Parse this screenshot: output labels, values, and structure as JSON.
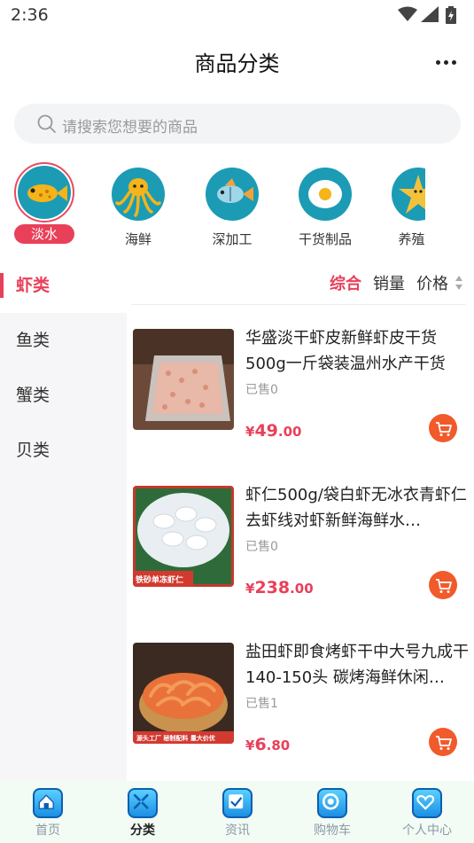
{
  "status_bar": {
    "time": "2:36"
  },
  "header": {
    "title": "商品分类"
  },
  "search": {
    "placeholder": "请搜索您想要的商品"
  },
  "categories": [
    {
      "label": "淡水",
      "icon": "fish-icon",
      "active": true
    },
    {
      "label": "海鲜",
      "icon": "octopus-icon",
      "active": false
    },
    {
      "label": "深加工",
      "icon": "tropical-fish-icon",
      "active": false
    },
    {
      "label": "干货制品",
      "icon": "egg-icon",
      "active": false
    },
    {
      "label": "养殖原",
      "icon": "starfish-icon",
      "active": false
    }
  ],
  "side_nav": [
    {
      "label": "虾类",
      "active": true
    },
    {
      "label": "鱼类",
      "active": false
    },
    {
      "label": "蟹类",
      "active": false
    },
    {
      "label": "贝类",
      "active": false
    }
  ],
  "sort": {
    "comprehensive": "综合",
    "sales": "销量",
    "price": "价格"
  },
  "products": [
    {
      "title": "华盛淡干虾皮新鲜虾皮干货500g一斤袋装温州水产干货",
      "sold": "已售0",
      "price_currency": "¥",
      "price_int": "49",
      "price_dec": ".00"
    },
    {
      "title": "虾仁500g/袋白虾无冰衣青虾仁去虾线对虾新鲜海鲜水…",
      "sold": "已售0",
      "price_currency": "¥",
      "price_int": "238",
      "price_dec": ".00",
      "image_text": "铁砂单冻虾仁"
    },
    {
      "title": "盐田虾即食烤虾干中大号九成干140-150头 碳烤海鲜休闲…",
      "sold": "已售1",
      "price_currency": "¥",
      "price_int": "6",
      "price_dec": ".80",
      "image_text": "源头工厂 秘制配料 量大价优"
    }
  ],
  "tab_bar": [
    {
      "label": "首页",
      "icon": "home-icon",
      "active": false
    },
    {
      "label": "分类",
      "icon": "category-icon",
      "active": true
    },
    {
      "label": "资讯",
      "icon": "news-icon",
      "active": false
    },
    {
      "label": "购物车",
      "icon": "cart-icon",
      "active": false
    },
    {
      "label": "个人中心",
      "icon": "heart-icon",
      "active": false
    }
  ],
  "colors": {
    "accent": "#e9405a",
    "cart": "#f15a2b",
    "teal": "#1c9bb5"
  }
}
